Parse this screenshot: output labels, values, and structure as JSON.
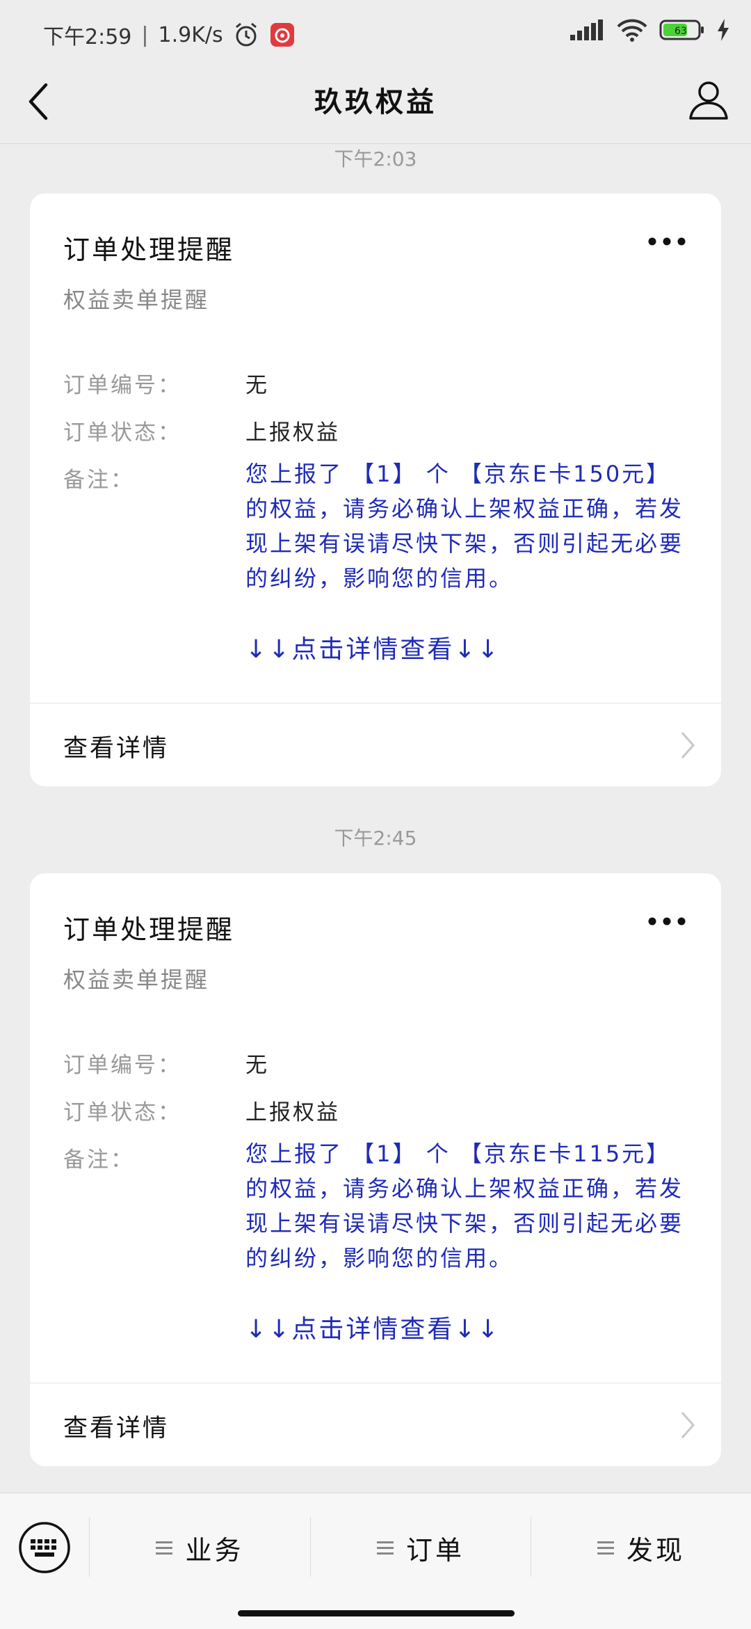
{
  "status_bar": {
    "time": "下午2:59",
    "speed": "1.9K/s",
    "battery": "63"
  },
  "nav": {
    "title": "玖玖权益"
  },
  "messages": [
    {
      "time": "下午2:03",
      "title": "订单处理提醒",
      "subtitle": "权益卖单提醒",
      "order_no_label": "订单编号：",
      "order_no": "无",
      "status_label": "订单状态：",
      "status": "上报权益",
      "remark_label": "备注：",
      "remark": "您上报了 【1】 个 【京东E卡150元】 的权益，请务必确认上架权益正确，若发现上架有误请尽快下架，否则引起无必要的纠纷，影响您的信用。",
      "hint": "↓↓点击详情查看↓↓",
      "detail_label": "查看详情"
    },
    {
      "time": "下午2:45",
      "title": "订单处理提醒",
      "subtitle": "权益卖单提醒",
      "order_no_label": "订单编号：",
      "order_no": "无",
      "status_label": "订单状态：",
      "status": "上报权益",
      "remark_label": "备注：",
      "remark": "您上报了 【1】 个 【京东E卡115元】 的权益，请务必确认上架权益正确，若发现上架有误请尽快下架，否则引起无必要的纠纷，影响您的信用。",
      "hint": "↓↓点击详情查看↓↓",
      "detail_label": "查看详情"
    }
  ],
  "tabs": [
    {
      "label": "业务",
      "icon": "menu-icon"
    },
    {
      "label": "订单",
      "icon": "menu-icon"
    },
    {
      "label": "发现",
      "icon": "menu-icon"
    }
  ],
  "icons": {
    "back": "back-arrow-icon",
    "profile": "user-icon",
    "keyboard": "keyboard-icon",
    "more": "more-dots-icon",
    "chevron": "chevron-right-icon"
  },
  "colors": {
    "remark_text": "#1f2bb5",
    "background": "#ededed",
    "card": "#ffffff"
  }
}
